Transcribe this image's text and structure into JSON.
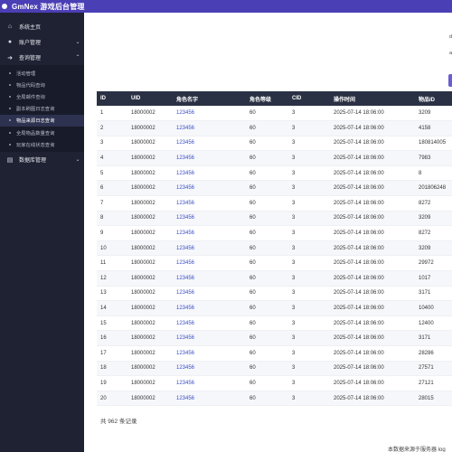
{
  "app": {
    "title": "GmNex 游戏后台管理"
  },
  "sidebar": {
    "home": {
      "label": "系统主页",
      "icon": "home-icon"
    },
    "account": {
      "label": "账户管理",
      "icon": "user-icon"
    },
    "query": {
      "label": "查询管理",
      "icon": "login-icon"
    },
    "sub_items": [
      {
        "label": "活动管理"
      },
      {
        "label": "物品代码查询"
      },
      {
        "label": "全局邮件查询"
      },
      {
        "label": "副本刷图日志查询"
      },
      {
        "label": "物品来源日志查询"
      },
      {
        "label": "全局物品数量查询"
      },
      {
        "label": "玩家在线状态查询"
      }
    ],
    "database": {
      "label": "数据库管理",
      "icon": "database-icon"
    }
  },
  "main": {
    "stub_a": "d",
    "stub_b": "a",
    "columns": [
      "ID",
      "UID",
      "角色名字",
      "角色等级",
      "CID",
      "操作时间",
      "物品ID"
    ],
    "rows": [
      [
        "1",
        "18000002",
        "123456",
        "60",
        "3",
        "2025-07-14 18:06:00",
        "3209"
      ],
      [
        "2",
        "18000002",
        "123456",
        "60",
        "3",
        "2025-07-14 18:06:00",
        "4158"
      ],
      [
        "3",
        "18000002",
        "123456",
        "60",
        "3",
        "2025-07-14 18:06:00",
        "180814005"
      ],
      [
        "4",
        "18000002",
        "123456",
        "60",
        "3",
        "2025-07-14 18:06:00",
        "7983"
      ],
      [
        "5",
        "18000002",
        "123456",
        "60",
        "3",
        "2025-07-14 18:06:00",
        "8"
      ],
      [
        "6",
        "18000002",
        "123456",
        "60",
        "3",
        "2025-07-14 18:06:00",
        "201806248"
      ],
      [
        "7",
        "18000002",
        "123456",
        "60",
        "3",
        "2025-07-14 18:06:00",
        "8272"
      ],
      [
        "8",
        "18000002",
        "123456",
        "60",
        "3",
        "2025-07-14 18:06:00",
        "3209"
      ],
      [
        "9",
        "18000002",
        "123456",
        "60",
        "3",
        "2025-07-14 18:06:00",
        "8272"
      ],
      [
        "10",
        "18000002",
        "123456",
        "60",
        "3",
        "2025-07-14 18:06:00",
        "3209"
      ],
      [
        "11",
        "18000002",
        "123456",
        "60",
        "3",
        "2025-07-14 18:06:00",
        "29972"
      ],
      [
        "12",
        "18000002",
        "123456",
        "60",
        "3",
        "2025-07-14 18:06:00",
        "1017"
      ],
      [
        "13",
        "18000002",
        "123456",
        "60",
        "3",
        "2025-07-14 18:06:00",
        "3171"
      ],
      [
        "14",
        "18000002",
        "123456",
        "60",
        "3",
        "2025-07-14 18:06:00",
        "10400"
      ],
      [
        "15",
        "18000002",
        "123456",
        "60",
        "3",
        "2025-07-14 18:06:00",
        "12400"
      ],
      [
        "16",
        "18000002",
        "123456",
        "60",
        "3",
        "2025-07-14 18:06:00",
        "3171"
      ],
      [
        "17",
        "18000002",
        "123456",
        "60",
        "3",
        "2025-07-14 18:06:00",
        "28286"
      ],
      [
        "18",
        "18000002",
        "123456",
        "60",
        "3",
        "2025-07-14 18:06:00",
        "27571"
      ],
      [
        "19",
        "18000002",
        "123456",
        "60",
        "3",
        "2025-07-14 18:06:00",
        "27121"
      ],
      [
        "20",
        "18000002",
        "123456",
        "60",
        "3",
        "2025-07-14 18:06:00",
        "28015"
      ]
    ],
    "total_text": "共 962 条记录",
    "footer_note": "本数据来源于服务器 log"
  }
}
